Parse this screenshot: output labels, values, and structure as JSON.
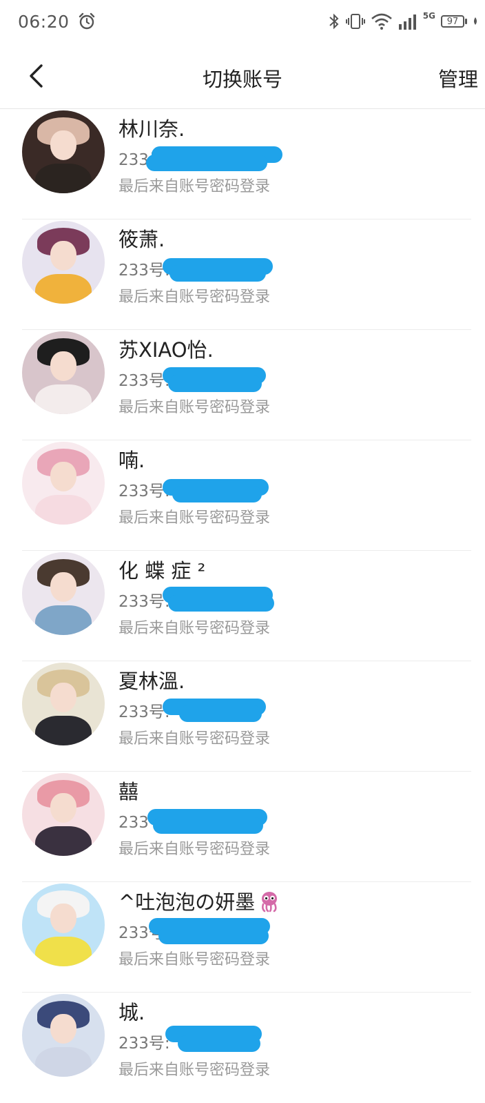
{
  "status_bar": {
    "time": "06:20",
    "network": "5G",
    "battery": "97",
    "icons": [
      "alarm-icon",
      "bluetooth-icon",
      "vibrate-icon",
      "wifi-icon",
      "signal-icon",
      "battery-icon"
    ]
  },
  "header": {
    "back_icon": "chevron-left-icon",
    "title": "切换账号",
    "manage_label": "管理"
  },
  "accounts": [
    {
      "nickname": "林川奈.",
      "uid_prefix": "233号",
      "last_login": "最后来自账号密码登录",
      "avatar_colors": [
        "#3a2a26",
        "#d9b7a6",
        "#2b2420"
      ]
    },
    {
      "nickname": "筱萧.",
      "uid_prefix": "233号:",
      "last_login": "最后来自账号密码登录",
      "avatar_colors": [
        "#e7e3ef",
        "#7b3b5a",
        "#f0b23c"
      ]
    },
    {
      "nickname": "苏XIAO怡.",
      "uid_prefix": "233号:",
      "last_login": "最后来自账号密码登录",
      "avatar_colors": [
        "#d8c5cb",
        "#1e1e1e",
        "#f3ecec"
      ]
    },
    {
      "nickname": "喃.",
      "uid_prefix": "233号:",
      "last_login": "最后来自账号密码登录",
      "avatar_colors": [
        "#f8eaee",
        "#e9a6b8",
        "#f6dbe1"
      ]
    },
    {
      "nickname": "化 蝶 症 ²",
      "uid_prefix": "233号:",
      "last_login": "最后来自账号密码登录",
      "avatar_colors": [
        "#ece6ee",
        "#4a3a30",
        "#7fa6c8"
      ]
    },
    {
      "nickname": "夏林溫.",
      "uid_prefix": "233号:",
      "last_login": "最后来自账号密码登录",
      "avatar_colors": [
        "#e9e4d4",
        "#d9c49a",
        "#2a2a30"
      ]
    },
    {
      "nickname": "囍",
      "uid_prefix": "233号",
      "last_login": "最后来自账号密码登录",
      "avatar_colors": [
        "#f6dfe3",
        "#e99aa6",
        "#3a3140"
      ]
    },
    {
      "nickname": "^吐泡泡の妍墨",
      "uid_prefix": "233号:",
      "last_login": "最后来自账号密码登录",
      "avatar_colors": [
        "#bfe3f7",
        "#f4f4f4",
        "#f0e04a"
      ],
      "badge_icon": "octopus-emoji-icon"
    },
    {
      "nickname": "城.",
      "uid_prefix": "233号:",
      "last_login": "最后来自账号密码登录",
      "avatar_colors": [
        "#d7e0ee",
        "#3b4a7a",
        "#cfd6e6"
      ]
    }
  ]
}
